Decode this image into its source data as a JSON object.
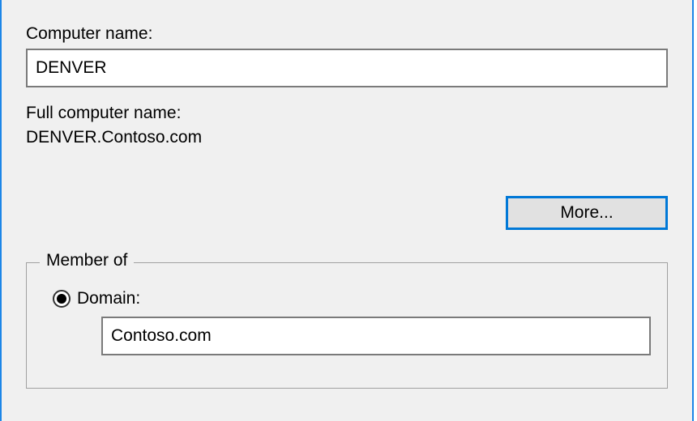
{
  "computerName": {
    "label": "Computer name:",
    "value": "DENVER"
  },
  "fullComputerName": {
    "label": "Full computer name:",
    "value": "DENVER.Contoso.com"
  },
  "moreButton": {
    "label": "More..."
  },
  "memberOf": {
    "legend": "Member of",
    "domain": {
      "label": "Domain:",
      "value": "Contoso.com",
      "selected": true
    }
  }
}
